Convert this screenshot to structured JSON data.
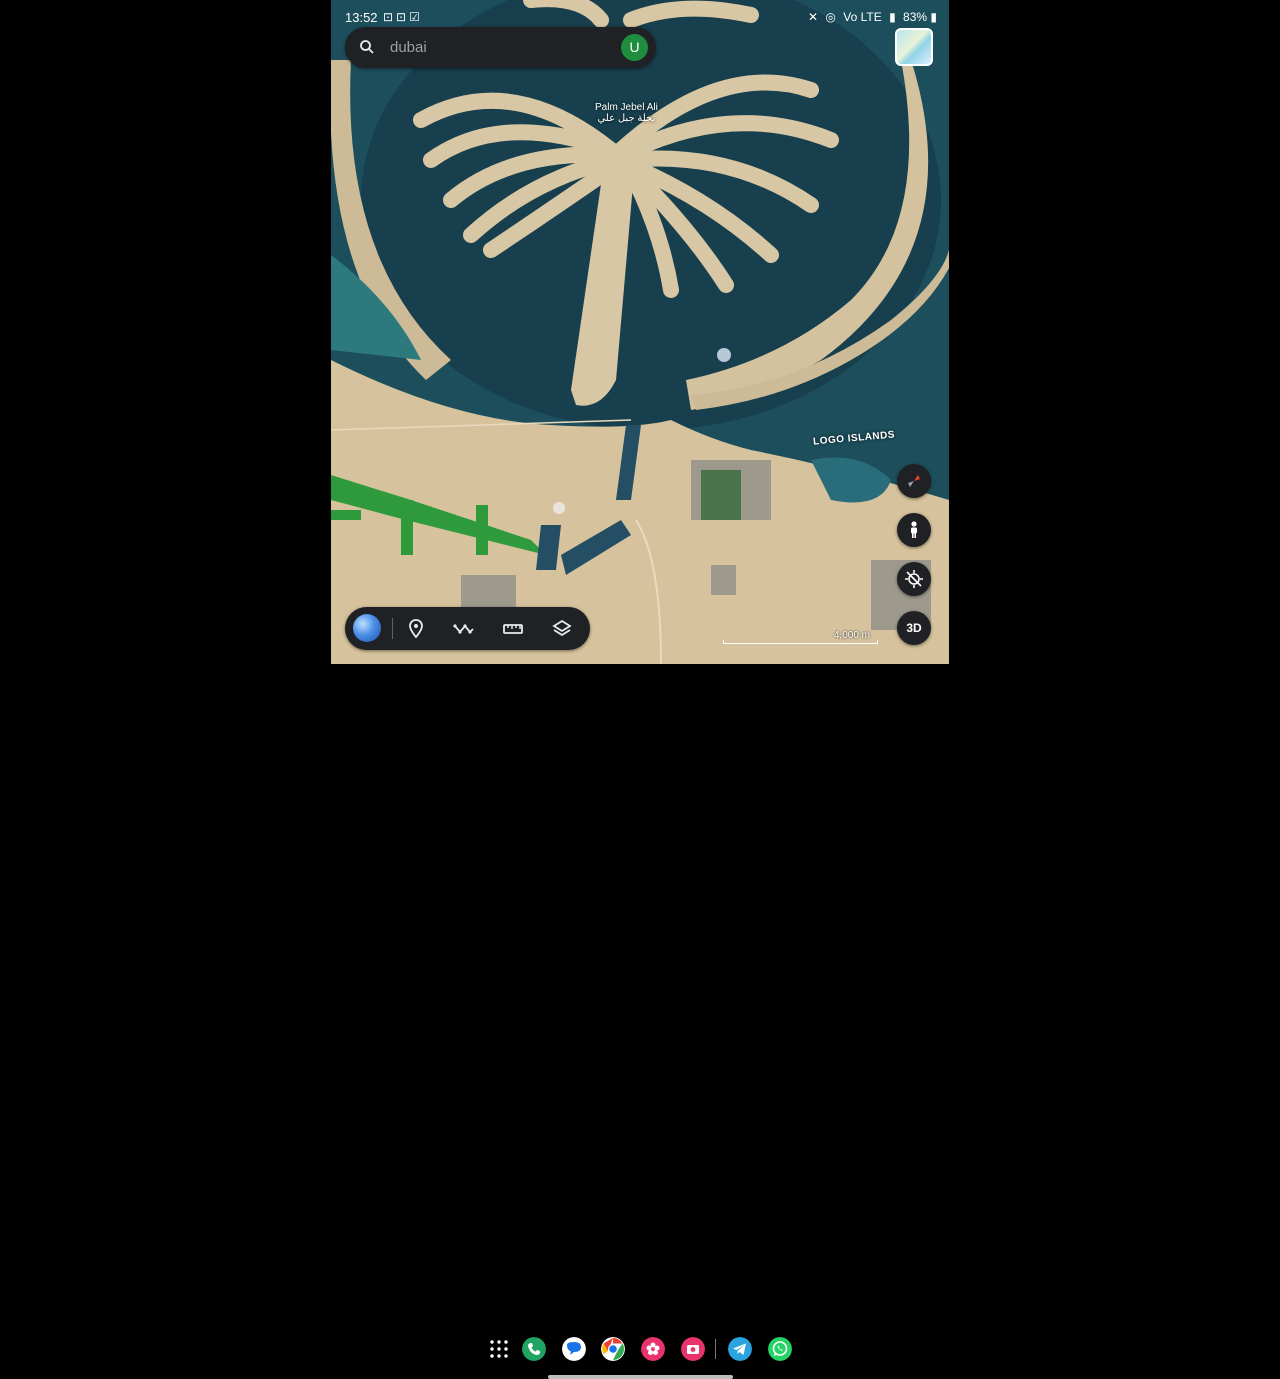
{
  "status_bar": {
    "time": "13:52",
    "battery": "83%",
    "network": "Vo LTE"
  },
  "search": {
    "query": "dubai",
    "avatar_initial": "U"
  },
  "map_labels": {
    "palm_en": "Palm Jebel Ali",
    "palm_ar": "نخلة جبل علي",
    "logo_islands": "LOGO ISLANDS"
  },
  "controls": {
    "three_d_label": "3D",
    "scale_label": "4,000 m"
  },
  "toolbar": {
    "items": [
      "globe",
      "place-pin",
      "path",
      "measure",
      "layers"
    ]
  },
  "taskbar_apps": [
    "app-grid",
    "phone",
    "messages",
    "chrome",
    "gallery",
    "screen-recorder",
    "telegram",
    "whatsapp"
  ],
  "colors": {
    "sea": "#1c4b5a",
    "sand": "#d9c8a6",
    "ui_dark": "#202124",
    "avatar": "#1e8e3e"
  }
}
